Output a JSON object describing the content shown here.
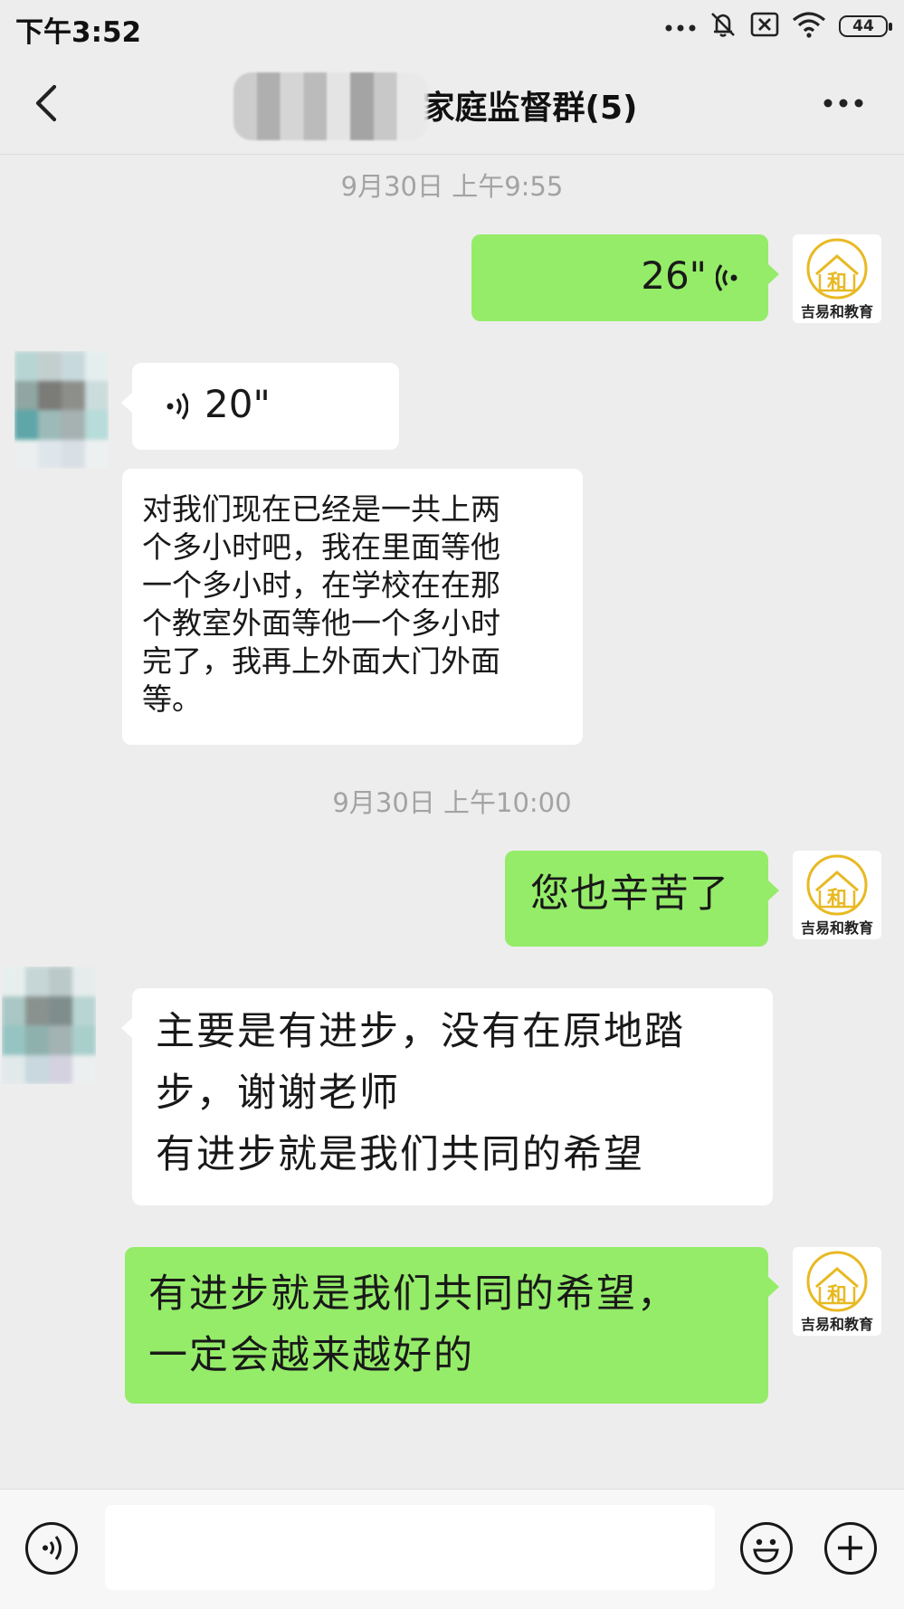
{
  "status_bar": {
    "time": "下午3:52",
    "battery": "44",
    "icons": [
      "more-dots-icon",
      "mute-bell-icon",
      "no-sim-icon",
      "wifi-icon",
      "battery-icon"
    ]
  },
  "nav": {
    "title": "家庭监督群(5)",
    "back_icon": "chevron-left-icon",
    "more_icon": "more-icon"
  },
  "messages": {
    "ts1": "9月30日  上午9:55",
    "voice_me": "26\"",
    "voice_them": "20\"",
    "text_them_1": [
      "对我们现在已经是一共上两",
      "个多小时吧，我在里面等他",
      "一个多小时，在学校在在那",
      "个教室外面等他一个多小时",
      "完了，我再上外面大门外面",
      "等。"
    ],
    "ts2": "9月30日  上午10:00",
    "text_me_1": "您也辛苦了",
    "text_them_2": [
      "主要是有进步，没有在原地踏",
      "步，谢谢老师",
      "有进步就是我们共同的希望"
    ],
    "text_me_2": [
      "有进步就是我们共同的希望，",
      "一定会越来越好的"
    ]
  },
  "avatar_me": {
    "label": "吉易和教育",
    "glyph": "和",
    "color": "#e8b923"
  },
  "bottom": {
    "icons": [
      "voice-input-icon",
      "emoji-icon",
      "plus-icon"
    ]
  }
}
